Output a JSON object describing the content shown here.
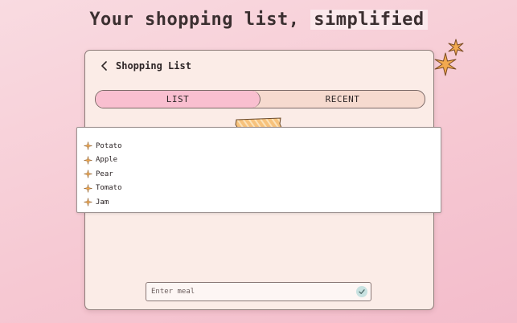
{
  "headline": {
    "part1": "Your shopping list, ",
    "highlight": "simplified"
  },
  "topbar": {
    "back_icon": "chevron-left-icon",
    "title": "Shopping List"
  },
  "tabs": [
    {
      "label": "LIST",
      "active": true
    },
    {
      "label": "RECENT",
      "active": false
    }
  ],
  "list": {
    "bullet_icon": "sparkle-icon",
    "items": [
      "Potato",
      "Apple",
      "Pear",
      "Tomato",
      "Jam"
    ]
  },
  "meal_input": {
    "placeholder": "Enter meal",
    "value": "",
    "submit_icon": "checkmark-icon"
  },
  "colors": {
    "accent_pink": "#f9bfd0",
    "tab_bg": "#f6dacf",
    "card_bg": "#fbece7",
    "sparkle": "#f0a64a",
    "check_bg": "#c8e2e1"
  }
}
